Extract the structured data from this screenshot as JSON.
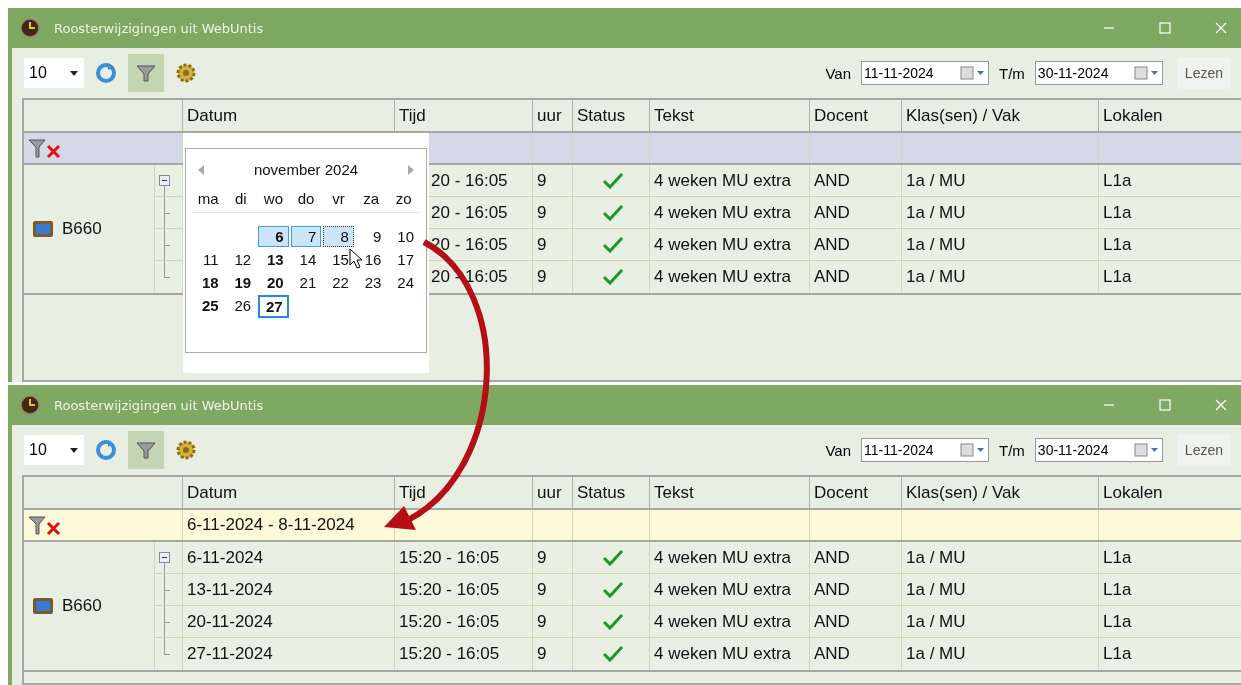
{
  "windows": [
    {
      "title": "Roosterwijzigingen uit WebUntis",
      "toolbar": {
        "page_size": "10",
        "filter_on": true,
        "van_label": "Van",
        "van": "11-11-2024",
        "tm_label": "T/m",
        "tm": "30-11-2024",
        "read_button": "Lezen"
      },
      "columns": [
        "Datum",
        "Tijd",
        "uur",
        "Status",
        "Tekst",
        "Docent",
        "Klas(sen) / Vak",
        "Lokalen"
      ],
      "filter": {
        "active": false
      },
      "groups": [
        {
          "name": "B660",
          "expanded": true,
          "rows": [
            {
              "tijd": "20 - 16:05",
              "uur": "9",
              "confirmed": true,
              "tekst": "4 weken MU extra",
              "docent": "AND",
              "klas": "1a / MU",
              "lokalen": "L1a"
            },
            {
              "tijd": "20 - 16:05",
              "uur": "9",
              "confirmed": true,
              "tekst": "4 weken MU extra",
              "docent": "AND",
              "klas": "1a / MU",
              "lokalen": "L1a"
            },
            {
              "tijd": "20 - 16:05",
              "uur": "9",
              "confirmed": true,
              "tekst": "4 weken MU extra",
              "docent": "AND",
              "klas": "1a / MU",
              "lokalen": "L1a"
            },
            {
              "tijd": "20 - 16:05",
              "uur": "9",
              "confirmed": true,
              "tekst": "4 weken MU extra",
              "docent": "AND",
              "klas": "1a / MU",
              "lokalen": "L1a"
            }
          ]
        }
      ],
      "calendar": {
        "month": "november 2024",
        "weekdays": [
          "ma",
          "di",
          "wo",
          "do",
          "vr",
          "za",
          "zo"
        ],
        "weeks": [
          [
            {
              "label": "6",
              "bold": true,
              "selected": true,
              "focused": false,
              "today": false
            },
            {
              "label": "7",
              "bold": false,
              "selected": true,
              "focused": false,
              "today": false
            },
            {
              "label": "8",
              "bold": false,
              "selected": true,
              "focused": true,
              "today": false
            },
            {
              "label": "9",
              "bold": false,
              "selected": false,
              "focused": false,
              "today": false
            },
            {
              "label": "10",
              "bold": false,
              "selected": false,
              "focused": false,
              "today": false
            }
          ],
          [
            {
              "label": "11",
              "bold": false,
              "selected": false,
              "focused": false,
              "today": false
            },
            {
              "label": "12",
              "bold": false,
              "selected": false,
              "focused": false,
              "today": false
            },
            {
              "label": "13",
              "bold": true,
              "selected": false,
              "focused": false,
              "today": false
            },
            {
              "label": "14",
              "bold": false,
              "selected": false,
              "focused": false,
              "today": false
            },
            {
              "label": "15",
              "bold": false,
              "selected": false,
              "focused": false,
              "today": false
            },
            {
              "label": "16",
              "bold": false,
              "selected": false,
              "focused": false,
              "today": false
            },
            {
              "label": "17",
              "bold": false,
              "selected": false,
              "focused": false,
              "today": false
            }
          ],
          [
            {
              "label": "18",
              "bold": true,
              "selected": false,
              "focused": false,
              "today": false
            },
            {
              "label": "19",
              "bold": true,
              "selected": false,
              "focused": false,
              "today": false
            },
            {
              "label": "20",
              "bold": true,
              "selected": false,
              "focused": false,
              "today": false
            },
            {
              "label": "21",
              "bold": false,
              "selected": false,
              "focused": false,
              "today": false
            },
            {
              "label": "22",
              "bold": false,
              "selected": false,
              "focused": false,
              "today": false
            },
            {
              "label": "23",
              "bold": false,
              "selected": false,
              "focused": false,
              "today": false
            },
            {
              "label": "24",
              "bold": false,
              "selected": false,
              "focused": false,
              "today": false
            }
          ],
          [
            {
              "label": "25",
              "bold": true,
              "selected": false,
              "focused": false,
              "today": false
            },
            {
              "label": "26",
              "bold": false,
              "selected": false,
              "focused": false,
              "today": false
            },
            {
              "label": "27",
              "bold": true,
              "selected": false,
              "focused": false,
              "today": true
            }
          ]
        ]
      }
    },
    {
      "title": "Roosterwijzigingen uit WebUntis",
      "toolbar": {
        "page_size": "10",
        "filter_on": true,
        "van_label": "Van",
        "van": "11-11-2024",
        "tm_label": "T/m",
        "tm": "30-11-2024",
        "read_button": "Lezen"
      },
      "columns": [
        "Datum",
        "Tijd",
        "uur",
        "Status",
        "Tekst",
        "Docent",
        "Klas(sen) / Vak",
        "Lokalen"
      ],
      "filter": {
        "active": true,
        "value": "6-11-2024 - 8-11-2024"
      },
      "groups": [
        {
          "name": "B660",
          "expanded": true,
          "rows": [
            {
              "datum": "6-11-2024",
              "tijd": "15:20 - 16:05",
              "uur": "9",
              "confirmed": true,
              "tekst": "4 weken MU extra",
              "docent": "AND",
              "klas": "1a / MU",
              "lokalen": "L1a"
            },
            {
              "datum": "13-11-2024",
              "tijd": "15:20 - 16:05",
              "uur": "9",
              "confirmed": true,
              "tekst": "4 weken MU extra",
              "docent": "AND",
              "klas": "1a / MU",
              "lokalen": "L1a"
            },
            {
              "datum": "20-11-2024",
              "tijd": "15:20 - 16:05",
              "uur": "9",
              "confirmed": true,
              "tekst": "4 weken MU extra",
              "docent": "AND",
              "klas": "1a / MU",
              "lokalen": "L1a"
            },
            {
              "datum": "27-11-2024",
              "tijd": "15:20 - 16:05",
              "uur": "9",
              "confirmed": true,
              "tekst": "4 weken MU extra",
              "docent": "AND",
              "klas": "1a / MU",
              "lokalen": "L1a"
            }
          ]
        }
      ]
    }
  ]
}
